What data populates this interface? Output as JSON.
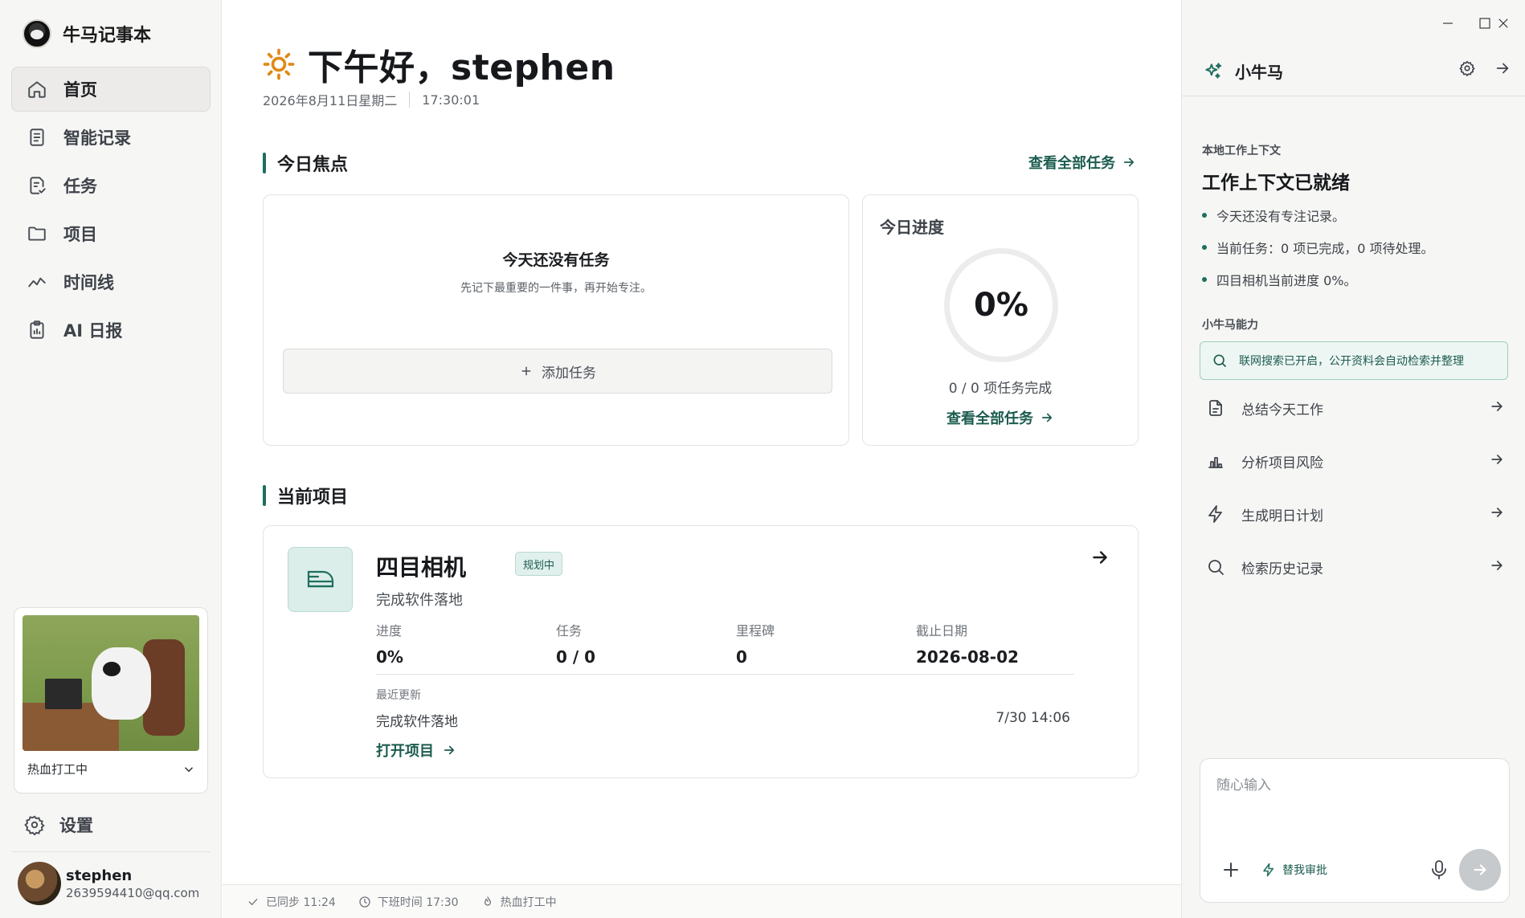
{
  "app": {
    "name": "牛马记事本"
  },
  "sidebar": {
    "items": [
      {
        "label": "首页",
        "icon": "home-icon",
        "active": true
      },
      {
        "label": "智能记录",
        "icon": "note-icon"
      },
      {
        "label": "任务",
        "icon": "task-icon"
      },
      {
        "label": "项目",
        "icon": "folder-icon"
      },
      {
        "label": "时间线",
        "icon": "timeline-icon"
      },
      {
        "label": "AI 日报",
        "icon": "report-icon"
      }
    ],
    "status_card": {
      "label": "热血打工中",
      "image": "cow-working-at-desk"
    },
    "settings_label": "设置",
    "user": {
      "name": "stephen",
      "email": "2639594410@qq.com"
    }
  },
  "header": {
    "greeting": "下午好，stephen",
    "date": "2026年8月11日星期二",
    "time": "17:30:01"
  },
  "focus": {
    "title": "今日焦点",
    "view_all": "查看全部任务",
    "empty_title": "今天还没有任务",
    "empty_sub": "先记下最重要的一件事，再开始专注。",
    "add_task": "添加任务"
  },
  "progress": {
    "title": "今日进度",
    "percent_label": "0%",
    "percent": 0,
    "count": "0 / 0 项任务完成",
    "view_all": "查看全部任务"
  },
  "projects": {
    "title": "当前项目",
    "current": {
      "name": "四目相机",
      "badge": "规划中",
      "description": "完成软件落地",
      "stats": [
        {
          "label": "进度",
          "value": "0%"
        },
        {
          "label": "任务",
          "value": "0 / 0"
        },
        {
          "label": "里程碑",
          "value": "0"
        },
        {
          "label": "截止日期",
          "value": "2026-08-02"
        }
      ],
      "recent_label": "最近更新",
      "recent_text": "完成软件落地",
      "recent_time": "7/30 14:06",
      "open_label": "打开项目"
    }
  },
  "footer": {
    "synced": "已同步 11:24",
    "off_work": "下班时间 17:30",
    "status": "热血打工中"
  },
  "assistant": {
    "title": "小牛马",
    "context_label": "本地工作上下文",
    "context_title": "工作上下文已就绪",
    "context_items": [
      "今天还没有专注记录。",
      "当前任务：0 项已完成，0 项待处理。",
      "四目相机当前进度 0%。"
    ],
    "capabilities_label": "小牛马能力",
    "search_notice": "联网搜索已开启，公开资料会自动检索并整理",
    "capabilities": [
      {
        "label": "总结今天工作",
        "icon": "document-icon"
      },
      {
        "label": "分析项目风险",
        "icon": "bar-chart-icon"
      },
      {
        "label": "生成明日计划",
        "icon": "lightning-icon"
      },
      {
        "label": "检索历史记录",
        "icon": "search-icon"
      }
    ],
    "input_placeholder": "随心输入",
    "mode_label": "替我审批"
  },
  "colors": {
    "accent": "#1f6e5e",
    "sun": "#e08a16"
  }
}
